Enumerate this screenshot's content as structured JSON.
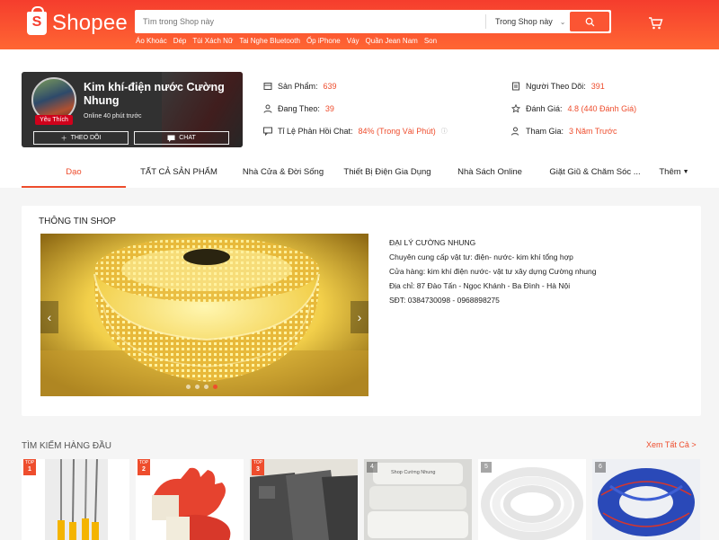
{
  "header": {
    "logo_text": "Shopee",
    "search_placeholder": "Tìm trong Shop này",
    "search_scope": "Trong Shop này",
    "hints": [
      "Áo Khoác",
      "Dép",
      "Túi Xách Nữ",
      "Tai Nghe Bluetooth",
      "Ốp iPhone",
      "Váy",
      "Quần Jean Nam",
      "Son"
    ]
  },
  "shop": {
    "name": "Kim khí-điện nước Cường Nhung",
    "online": "Online 40 phút trước",
    "badge": "Yêu Thích",
    "follow_label": "THEO DÕI",
    "chat_label": "CHAT",
    "stats": {
      "products_label": "Sản Phẩm:",
      "products_value": "639",
      "following_label": "Đang Theo:",
      "following_value": "39",
      "chat_label": "Tỉ Lệ Phản Hồi Chat:",
      "chat_value": "84% (Trong Vài Phút)",
      "followers_label": "Người Theo Dõi:",
      "followers_value": "391",
      "rating_label": "Đánh Giá:",
      "rating_value": "4.8 (440 Đánh Giá)",
      "joined_label": "Tham Gia:",
      "joined_value": "3 Năm Trước"
    }
  },
  "tabs": [
    "Dạo",
    "TẤT CẢ SẢN PHẨM",
    "Nhà Cửa & Đời Sống",
    "Thiết Bị Điện Gia Dụng",
    "Nhà Sách Online",
    "Giặt Giũ & Chăm Sóc ...",
    "Thêm"
  ],
  "info": {
    "title": "THÔNG TIN SHOP",
    "lines": [
      "ĐẠI LÝ CƯỜNG NHUNG",
      "Chuyên cung cấp vật tư: điện- nước- kim khí tổng hợp",
      "Cửa hàng: kim khí điện nước- vật tư xây dựng Cường nhung",
      "Địa chỉ: 87 Đào Tấn - Ngọc Khánh - Ba Đình - Hà Nội",
      "SĐT: 0384730098 - 0968898275"
    ],
    "slide_count": 4,
    "active_slide": 3
  },
  "top_search": {
    "title": "TÌM KIẾM HÀNG ĐẦU",
    "see_all": "Xem Tất Cả",
    "top_label": "TOP",
    "items": [
      {
        "rank": "1"
      },
      {
        "rank": "2"
      },
      {
        "rank": "3"
      },
      {
        "rank": "4",
        "caption": "Shop Cường Nhung"
      },
      {
        "rank": "5"
      },
      {
        "rank": "6"
      }
    ]
  },
  "colors": {
    "brand": "#ee4d2d",
    "header_top": "#f53d2d",
    "header_bottom": "#ff6633"
  }
}
